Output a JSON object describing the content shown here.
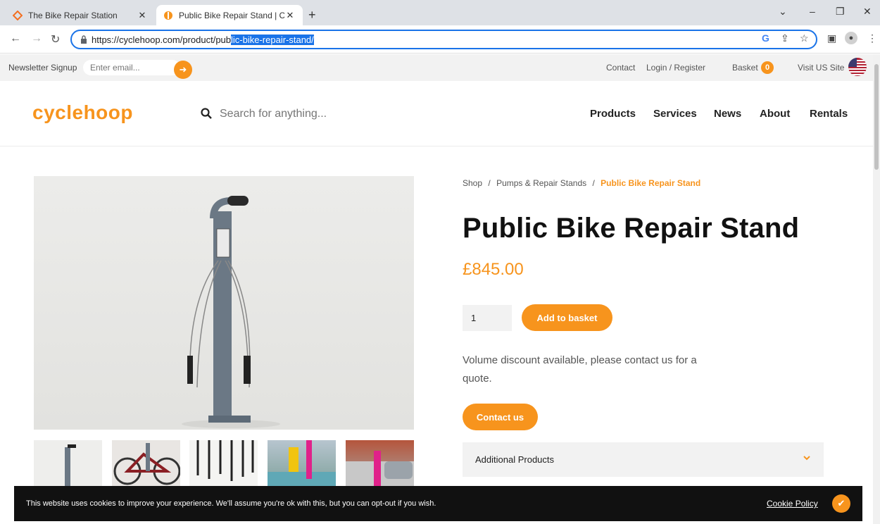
{
  "browser": {
    "tabs": [
      {
        "title": "The Bike Repair Station",
        "active": false
      },
      {
        "title": "Public Bike Repair Stand | Cyclehoop",
        "active": true
      }
    ],
    "url_plain": "https://cyclehoop.com/product/pub",
    "url_selected": "lic-bike-repair-stand/"
  },
  "topbar": {
    "newsletter_label": "Newsletter Signup",
    "email_placeholder": "Enter email...",
    "contact": "Contact",
    "login": "Login / Register",
    "basket": "Basket",
    "basket_count": "0",
    "visit_us": "Visit US Site"
  },
  "header": {
    "logo": "cyclehoop",
    "search_placeholder": "Search for anything...",
    "nav": [
      "Products",
      "Services",
      "News",
      "About",
      "Rentals"
    ]
  },
  "breadcrumb": {
    "shop": "Shop",
    "sep": "/",
    "category": "Pumps & Repair Stands",
    "current": "Public Bike Repair Stand"
  },
  "product": {
    "title": "Public Bike Repair Stand",
    "price": "£845.00",
    "quantity": "1",
    "add_to_basket": "Add to basket",
    "discount_text": "Volume discount available, please contact us for a quote.",
    "contact_button": "Contact us",
    "accordion_label": "Additional Products"
  },
  "cookie": {
    "message": "This website uses cookies to improve your experience. We'll assume you're ok with this, but you can opt-out if you wish.",
    "policy_link": "Cookie Policy"
  },
  "colors": {
    "brand_orange": "#f7941d",
    "chrome_bg": "#dee1e6",
    "focus_blue": "#1a73e8"
  },
  "icons": [
    "tab-favicon-icon",
    "close-icon",
    "new-tab-icon",
    "back-arrow-icon",
    "forward-arrow-icon",
    "reload-icon",
    "lock-icon",
    "google-icon",
    "share-icon",
    "star-icon",
    "sidepanel-icon",
    "profile-icon",
    "menu-icon",
    "arrow-right-icon",
    "us-flag-icon",
    "search-icon",
    "chevron-down-icon",
    "checkmark-icon"
  ]
}
